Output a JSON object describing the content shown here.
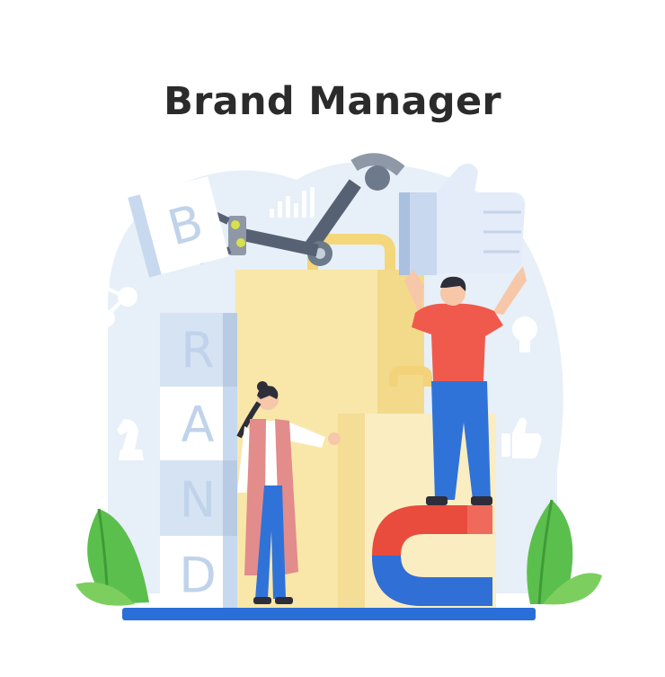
{
  "title": "Brand Manager",
  "blocks": {
    "floating": "B",
    "stack": [
      "R",
      "A",
      "N",
      "D"
    ]
  },
  "icons": [
    "bar-chart-icon",
    "share-network-icon",
    "chess-knight-icon",
    "lightbulb-icon",
    "thumbs-up-icon",
    "magnet-icon",
    "robotic-arm-icon"
  ],
  "colors": {
    "background_blob": "#e7eff8",
    "bag": "#f6e3a0",
    "floor": "#2a6fd8",
    "leaf": "#5bbf4d",
    "magnet_red": "#e94b3c",
    "magnet_blue": "#2f6fd6",
    "shirt": "#ef5a4c",
    "pants": "#2f73d8"
  }
}
